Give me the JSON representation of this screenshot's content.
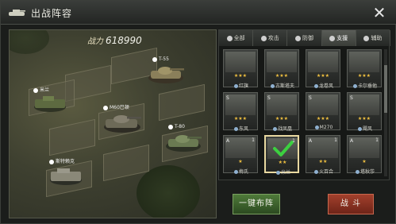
{
  "window": {
    "title": "出战阵容",
    "close_glyph": "✕"
  },
  "field": {
    "power_label": "战力",
    "power_value": "618990",
    "units": [
      {
        "label": "T-55"
      },
      {
        "label": "米兰"
      },
      {
        "label": "M60巴顿"
      },
      {
        "label": "T-80"
      },
      {
        "label": "斯特赖克"
      }
    ]
  },
  "tabs": [
    {
      "label": "全部",
      "icon": "people-icon"
    },
    {
      "label": "攻击",
      "icon": "sword-icon"
    },
    {
      "label": "防御",
      "icon": "shield-icon"
    },
    {
      "label": "支援",
      "icon": "support-icon"
    },
    {
      "label": "辅助",
      "icon": "plus-icon"
    }
  ],
  "cards": [
    {
      "name": "红旗",
      "stars": "★★★",
      "rank": "",
      "lv": ""
    },
    {
      "name": "古斯塔夫",
      "stars": "★★★",
      "rank": "",
      "lv": ""
    },
    {
      "name": "龙卷风",
      "stars": "★★★",
      "rank": "",
      "lv": ""
    },
    {
      "name": "卡尔垂他",
      "stars": "★★★",
      "rank": "",
      "lv": ""
    },
    {
      "name": "东风",
      "stars": "★★★",
      "rank": "S",
      "lv": ""
    },
    {
      "name": "战凤凰",
      "stars": "★★★",
      "rank": "S",
      "lv": ""
    },
    {
      "name": "M270",
      "stars": "★★★",
      "rank": "S",
      "lv": ""
    },
    {
      "name": "飓风",
      "stars": "★★★",
      "rank": "S",
      "lv": ""
    },
    {
      "name": "梅氏",
      "stars": "★",
      "rank": "A",
      "lv": "1"
    },
    {
      "name": "米兰",
      "stars": "★★",
      "rank": "",
      "lv": "1"
    },
    {
      "name": "火百合",
      "stars": "★★",
      "rank": "A",
      "lv": "1"
    },
    {
      "name": "塔秋莎",
      "stars": "★",
      "rank": "A",
      "lv": "1"
    }
  ],
  "buttons": {
    "deploy": "一键布阵",
    "battle": "战 斗"
  },
  "colors": {
    "deploy_green": "#4f7a3a",
    "battle_red": "#a2402c",
    "check_green": "#3cd040"
  }
}
